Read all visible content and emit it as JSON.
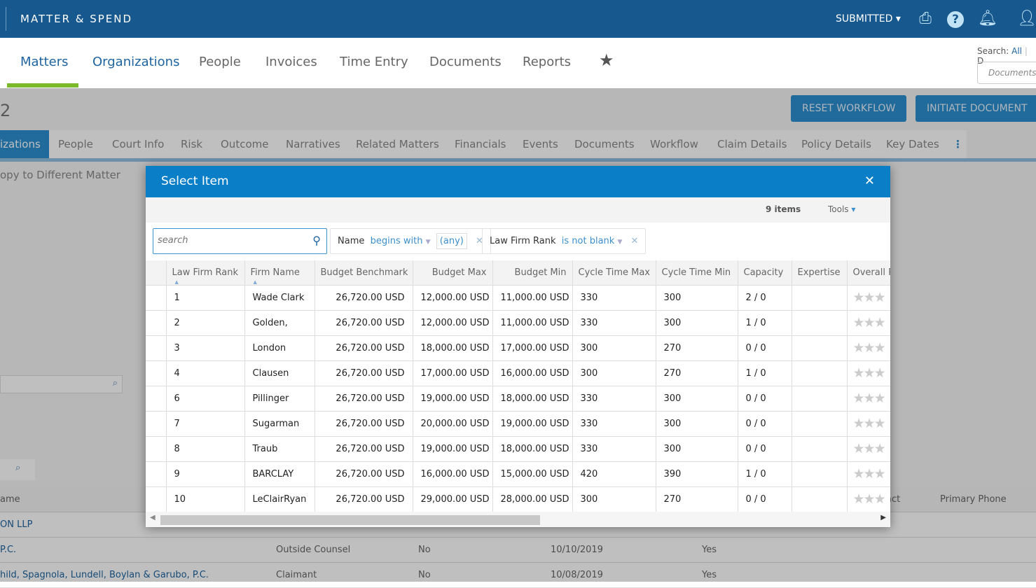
{
  "header": {
    "brand": "MATTER & SPEND",
    "status": "SUBMITTED",
    "icons": [
      "printer-icon",
      "help-icon",
      "bell-icon",
      "user-icon"
    ]
  },
  "nav": {
    "tabs": [
      "Matters",
      "Organizations",
      "People",
      "Invoices",
      "Time Entry",
      "Documents",
      "Reports"
    ],
    "active": "Matters",
    "search_label": "Search:",
    "search_scope": "All",
    "search_scope_next": "D",
    "search_placeholder": "Documents,"
  },
  "page": {
    "matter_number_fragment": "2",
    "buttons": [
      "RESET WORKFLOW",
      "INITIATE DOCUMENT"
    ],
    "subtabs": [
      "izations",
      "People",
      "Court Info",
      "Risk",
      "Outcome",
      "Narratives",
      "Related Matters",
      "Financials",
      "Events",
      "Documents",
      "Workflow",
      "Claim Details",
      "Policy Details",
      "Key Dates"
    ],
    "copy_link": "opy to Different Matter",
    "bg_table": {
      "headers": [
        "ame",
        "act",
        "Primary Phone"
      ],
      "rows": [
        {
          "name": "ON LLP",
          "type": "",
          "flag": "",
          "date": "",
          "yes": ""
        },
        {
          "name": "P.C.",
          "type": "Outside Counsel",
          "flag": "No",
          "date": "10/10/2019",
          "yes": "Yes"
        },
        {
          "name": "hild, Spagnola, Lundell, Boylan & Garubo, P.C.",
          "type": "Claimant",
          "flag": "No",
          "date": "10/08/2019",
          "yes": "Yes"
        }
      ]
    }
  },
  "modal": {
    "title": "Select Item",
    "item_count": "9 items",
    "tools_label": "Tools",
    "search_placeholder": "search",
    "filters": [
      {
        "field": "Name",
        "operator": "begins with",
        "value": "(any)"
      },
      {
        "field": "Law Firm Rank",
        "operator": "is not blank"
      }
    ],
    "columns": [
      "Law Firm Rank",
      "Firm Name",
      "Budget Benchmark",
      "Budget Max",
      "Budget Min",
      "Cycle Time Max",
      "Cycle Time Min",
      "Capacity",
      "Expertise",
      "Overall R"
    ],
    "rows": [
      [
        "1",
        "Wade Clark",
        "26,720.00 USD",
        "12,000.00 USD",
        "11,000.00 USD",
        "330",
        "300",
        "2 / 0",
        ""
      ],
      [
        "2",
        "Golden,",
        "26,720.00 USD",
        "12,000.00 USD",
        "11,000.00 USD",
        "330",
        "300",
        "1 / 0",
        ""
      ],
      [
        "3",
        "London",
        "26,720.00 USD",
        "18,000.00 USD",
        "17,000.00 USD",
        "300",
        "270",
        "0 / 0",
        ""
      ],
      [
        "4",
        "Clausen",
        "26,720.00 USD",
        "17,000.00 USD",
        "16,000.00 USD",
        "300",
        "270",
        "1 / 0",
        ""
      ],
      [
        "6",
        "Pillinger",
        "26,720.00 USD",
        "19,000.00 USD",
        "18,000.00 USD",
        "330",
        "300",
        "0 / 0",
        ""
      ],
      [
        "7",
        "Sugarman",
        "26,720.00 USD",
        "20,000.00 USD",
        "19,000.00 USD",
        "330",
        "300",
        "0 / 0",
        ""
      ],
      [
        "8",
        "Traub",
        "26,720.00 USD",
        "19,000.00 USD",
        "18,000.00 USD",
        "330",
        "300",
        "0 / 0",
        ""
      ],
      [
        "9",
        "BARCLAY",
        "26,720.00 USD",
        "16,000.00 USD",
        "15,000.00 USD",
        "420",
        "390",
        "1 / 0",
        ""
      ],
      [
        "10",
        "LeClairRyan",
        "26,720.00 USD",
        "29,000.00 USD",
        "28,000.00 USD",
        "300",
        "270",
        "0 / 0",
        ""
      ]
    ],
    "stars_glyph": "★★★"
  }
}
